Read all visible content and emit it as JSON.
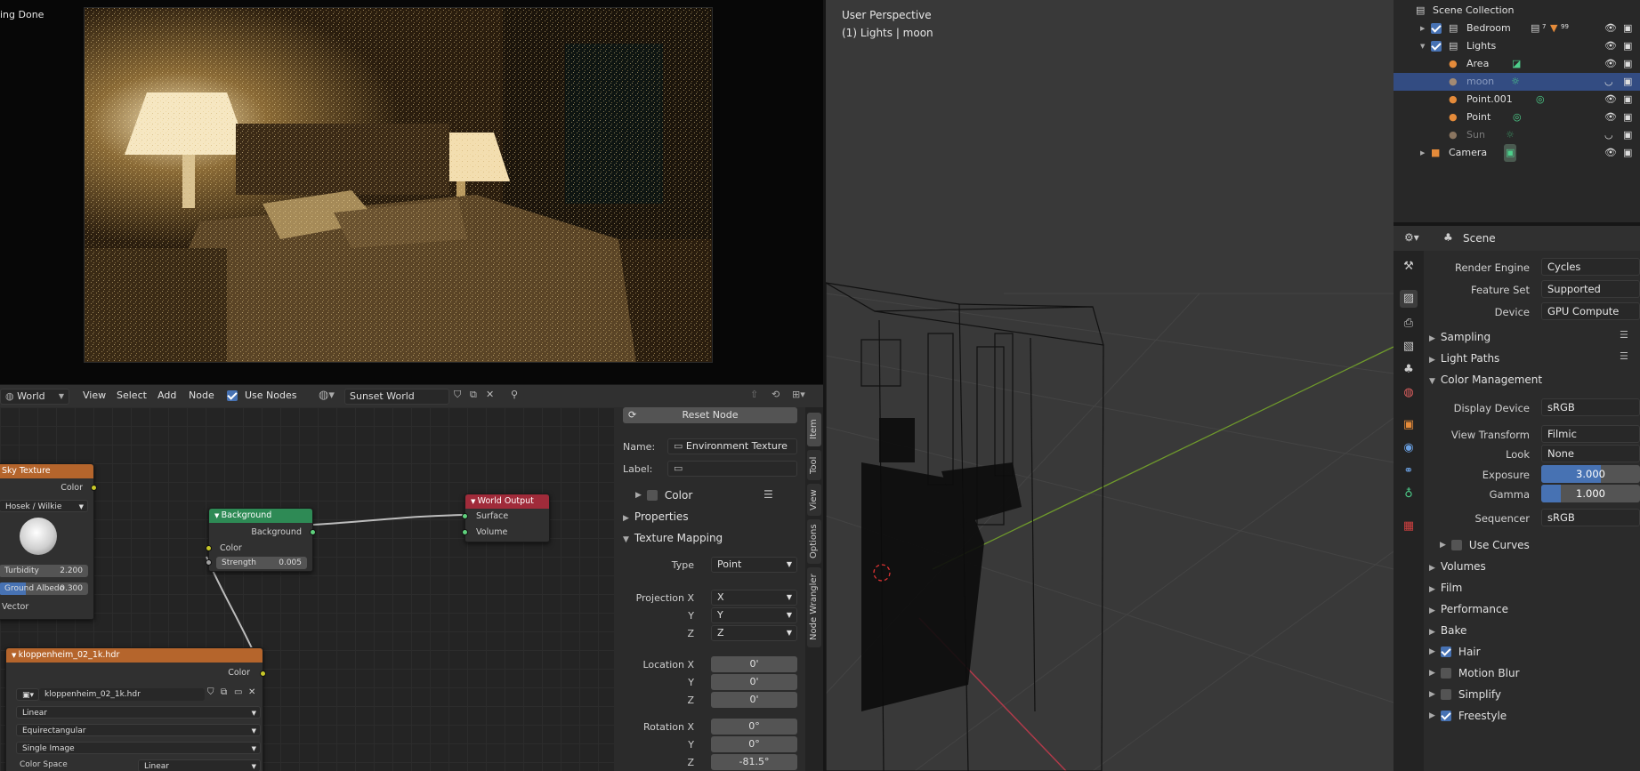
{
  "render": {
    "status": "ing Done"
  },
  "node_header": {
    "editor_type": "World",
    "menu": [
      "View",
      "Select",
      "Add",
      "Node"
    ],
    "use_nodes_label": "Use Nodes",
    "world_name": "Sunset World"
  },
  "nodes": {
    "sky": {
      "title": "Sky Texture",
      "out_color": "Color",
      "model": "Hosek / Wilkie",
      "turbidity_label": "Turbidity",
      "turbidity": "2.200",
      "albedo_label": "Ground Albedo",
      "albedo": "0.300",
      "albedo_fraction": 0.3,
      "vector": "Vector"
    },
    "background": {
      "title": "Background",
      "out": "Background",
      "in_color": "Color",
      "strength_label": "Strength",
      "strength": "0.005"
    },
    "world_output": {
      "title": "World Output",
      "surface": "Surface",
      "volume": "Volume"
    },
    "env": {
      "title": "kloppenheim_02_1k.hdr",
      "out_color": "Color",
      "image": "kloppenheim_02_1k.hdr",
      "interp": "Linear",
      "projection": "Equirectangular",
      "source": "Single Image",
      "cs_label": "Color Space",
      "color_space": "Linear"
    }
  },
  "sidebar": {
    "reset_node": "Reset Node",
    "name_label": "Name:",
    "name_value": "Environment Texture",
    "label_label": "Label:",
    "label_value": "",
    "color_label": "Color",
    "properties": "Properties",
    "texture_mapping": "Texture Mapping",
    "type_label": "Type",
    "type_value": "Point",
    "projection_x_label": "Projection X",
    "projection_x": "X",
    "y_label": "Y",
    "projection_y": "Y",
    "z_label": "Z",
    "projection_z": "Z",
    "location_x_label": "Location X",
    "location_x": "0'",
    "location_y": "0'",
    "location_z": "0'",
    "rotation_x_label": "Rotation X",
    "rotation_x": "0°",
    "rotation_y": "0°",
    "rotation_z": "-81.5°",
    "tabs": [
      "Item",
      "Tool",
      "View",
      "Options",
      "Node Wrangler"
    ]
  },
  "viewport": {
    "perspective": "User Perspective",
    "context": "(1) Lights | moon"
  },
  "outliner": {
    "title": "Scene Collection",
    "rows": [
      {
        "name": "Bedroom",
        "badge1": "7",
        "badge2": "99"
      },
      {
        "name": "Lights"
      },
      {
        "name": "Area"
      },
      {
        "name": "moon"
      },
      {
        "name": "Point.001"
      },
      {
        "name": "Point"
      },
      {
        "name": "Sun"
      },
      {
        "name": "Camera"
      }
    ]
  },
  "properties": {
    "scene_label": "Scene",
    "render_engine_label": "Render Engine",
    "render_engine": "Cycles",
    "feature_set_label": "Feature Set",
    "feature_set": "Supported",
    "device_label": "Device",
    "device": "GPU Compute",
    "sampling": "Sampling",
    "light_paths": "Light Paths",
    "color_management": "Color Management",
    "display_device_label": "Display Device",
    "display_device": "sRGB",
    "view_transform_label": "View Transform",
    "view_transform": "Filmic",
    "look_label": "Look",
    "look": "None",
    "exposure_label": "Exposure",
    "exposure": "3.000",
    "exposure_fraction": 0.6,
    "gamma_label": "Gamma",
    "gamma": "1.000",
    "gamma_fraction": 0.2,
    "sequencer_label": "Sequencer",
    "sequencer": "sRGB",
    "use_curves": "Use Curves",
    "sections": [
      "Volumes",
      "Film",
      "Performance",
      "Bake"
    ],
    "hair": "Hair",
    "motion_blur": "Motion Blur",
    "simplify": "Simplify",
    "freestyle": "Freestyle"
  },
  "colors": {
    "accent": "#4772b3",
    "selected_row": "#334c82",
    "node_texture": "#b5652c",
    "node_shader": "#2e8a55",
    "node_output": "#a02b3a",
    "socket_color": "#c7c729",
    "socket_shader": "#5fd17d"
  }
}
